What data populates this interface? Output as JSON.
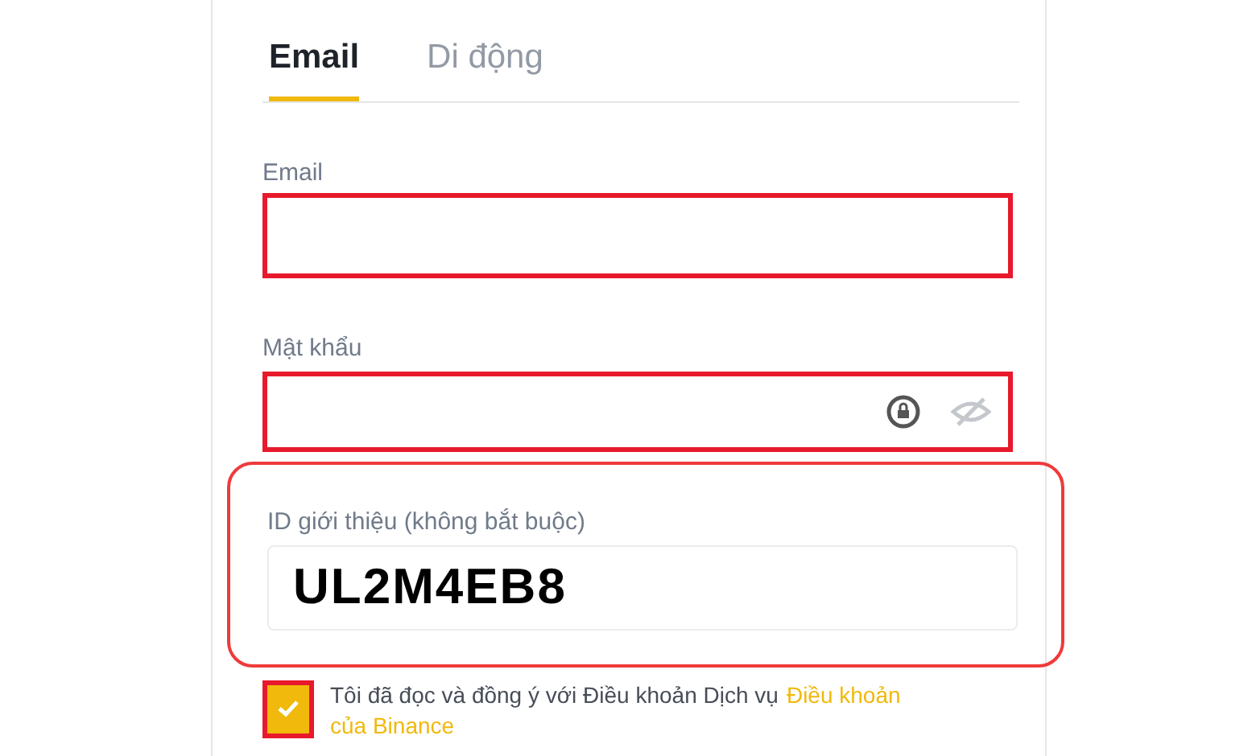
{
  "tabs": [
    {
      "label": "Email",
      "selected": true
    },
    {
      "label": "Di động",
      "selected": false
    }
  ],
  "email": {
    "label": "Email"
  },
  "password": {
    "label": "Mật khẩu"
  },
  "referral": {
    "label": "ID giới thiệu (không bắt buộc)",
    "value": "UL2M4EB8"
  },
  "agreement": {
    "checked": true,
    "text": "Tôi đã đọc và đồng ý với Điều khoản Dịch vụ",
    "link_first_line": "Điều khoản",
    "link_second_line": "của Binance"
  }
}
